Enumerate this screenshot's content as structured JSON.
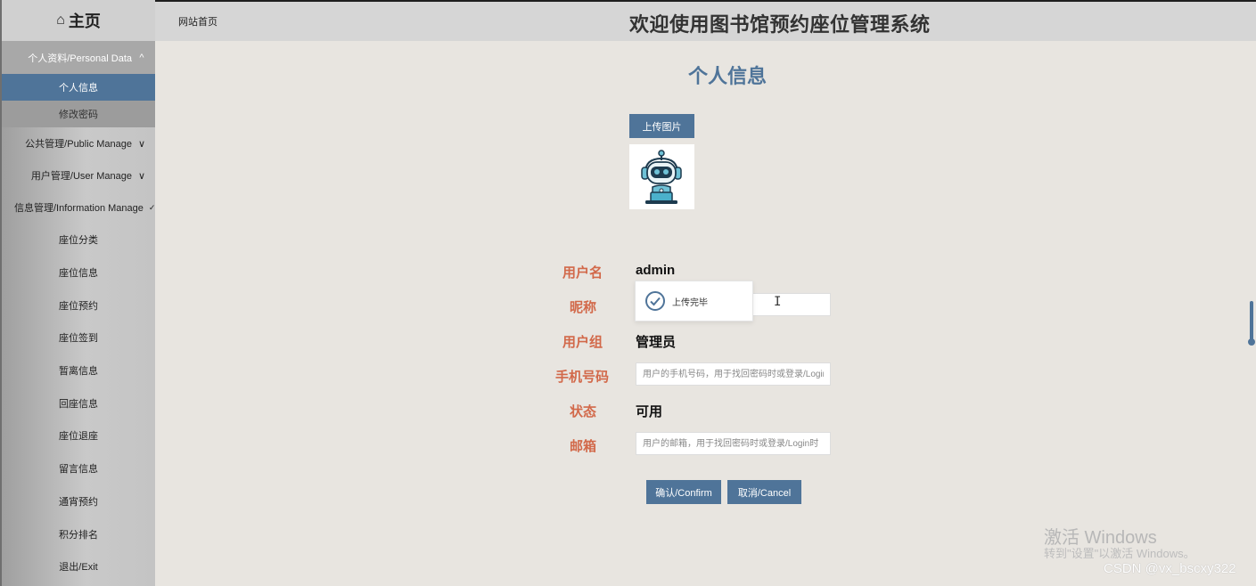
{
  "sidebar": {
    "home": {
      "icon": "home-icon",
      "label": "主页"
    },
    "personal": {
      "label": "个人资料/Personal Data",
      "chevron": "^",
      "items": [
        "个人信息",
        "修改密码"
      ]
    },
    "groups": [
      {
        "label": "公共管理/Public Manage",
        "chevron": "∨"
      },
      {
        "label": "用户管理/User Manage",
        "chevron": "∨"
      },
      {
        "label": "信息管理/Information Manage",
        "chevron": "✓"
      }
    ],
    "items": [
      "座位分类",
      "座位信息",
      "座位预约",
      "座位签到",
      "暂离信息",
      "回座信息",
      "座位退座",
      "留言信息",
      "通宵预约",
      "积分排名",
      "退出/Exit"
    ]
  },
  "header": {
    "site_home": "网站首页",
    "title": "欢迎使用图书馆预约座位管理系统"
  },
  "main": {
    "heading": "个人信息",
    "upload_label": "上传图片",
    "fields": {
      "username_label": "用户名",
      "username_value": "admin",
      "nickname_label": "昵称",
      "usergroup_label": "用户组",
      "usergroup_value": "管理员",
      "phone_label": "手机号码",
      "phone_placeholder": "用户的手机号码，用于找回密码时或登录/Login",
      "status_label": "状态",
      "status_value": "可用",
      "email_label": "邮箱",
      "email_placeholder": "用户的邮箱，用于找回密码时或登录/Login时"
    },
    "confirm_label": "确认/Confirm",
    "cancel_label": "取消/Cancel"
  },
  "toast": {
    "icon": "check-circle-icon",
    "text": "上传完毕"
  },
  "overlay": {
    "activate_title": "激活 Windows",
    "activate_sub": "转到\"设置\"以激活 Windows。",
    "csdn": "CSDN @vx_bscxy322"
  },
  "colors": {
    "accent": "#4f7499",
    "label": "#d2694a",
    "background": "#e8e5e0"
  }
}
